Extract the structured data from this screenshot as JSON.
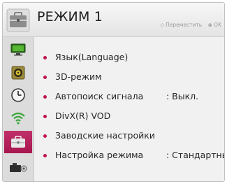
{
  "header": {
    "title": "РЕЖИМ 1",
    "hint_move": "Переместить",
    "hint_ok": "OK"
  },
  "sidebar": {
    "items": [
      {
        "icon": "picture-icon"
      },
      {
        "icon": "speaker-icon"
      },
      {
        "icon": "clock-icon"
      },
      {
        "icon": "wifi-icon"
      },
      {
        "icon": "toolbox-icon",
        "active": true
      },
      {
        "icon": "camera-icon"
      }
    ]
  },
  "menu": {
    "items": [
      {
        "label": "Язык(Language)",
        "value": ""
      },
      {
        "label": "3D-режим",
        "value": ""
      },
      {
        "label": "Автопоиск сигнала",
        "value": ": Выкл."
      },
      {
        "label": "DivX(R) VOD",
        "value": ""
      },
      {
        "label": "Заводские настройки",
        "value": ""
      },
      {
        "label": "Настройка режима",
        "value": ": Стандартный"
      }
    ]
  },
  "colors": {
    "accent": "#b81b57",
    "bullet": "#c1134e"
  }
}
